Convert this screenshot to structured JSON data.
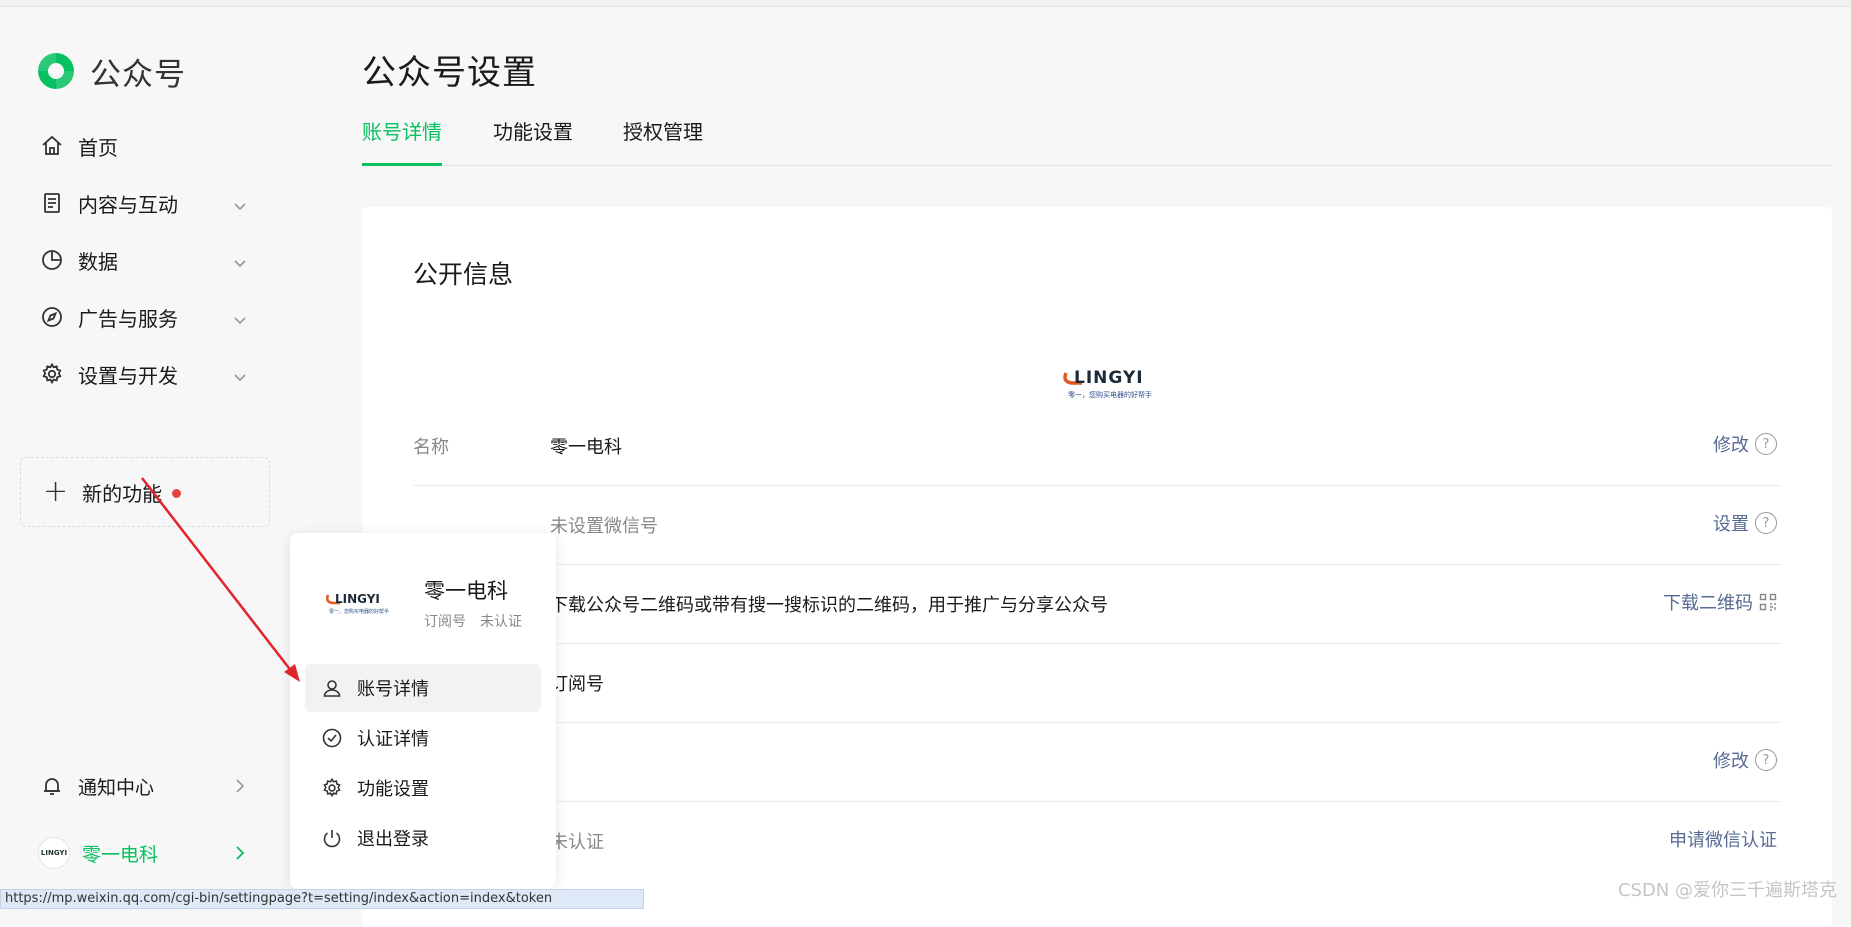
{
  "brand": {
    "title": "公众号"
  },
  "sidebar": {
    "items": [
      {
        "label": "首页",
        "icon": "home-icon"
      },
      {
        "label": "内容与互动",
        "icon": "document-icon"
      },
      {
        "label": "数据",
        "icon": "pie-chart-icon"
      },
      {
        "label": "广告与服务",
        "icon": "compass-icon"
      },
      {
        "label": "设置与开发",
        "icon": "gear-icon"
      }
    ],
    "new_feature": "新的功能",
    "notifications": "通知中心",
    "account_name": "零一电科"
  },
  "page": {
    "title": "公众号设置",
    "tabs": [
      "账号详情",
      "功能设置",
      "授权管理"
    ],
    "active_tab": 0
  },
  "card": {
    "title": "公开信息",
    "logo_text": "LINGYI",
    "logo_tagline": "零一，您购买电器的好帮手",
    "rows": [
      {
        "label": "名称",
        "value": "零一电科",
        "action": "修改",
        "help": true
      },
      {
        "label": "",
        "value": "未设置微信号",
        "action": "设置",
        "help": true,
        "muted": true
      },
      {
        "label": "",
        "value": "下载公众号二维码或带有搜一搜标识的二维码，用于推广与分享公众号",
        "action": "下载二维码",
        "qr": true
      },
      {
        "label": "",
        "value": "订阅号",
        "action": ""
      },
      {
        "label": "",
        "value": "",
        "action": "修改",
        "help": true
      },
      {
        "label": "",
        "value": "未认证",
        "action": "申请微信认证",
        "muted": true
      }
    ]
  },
  "popover": {
    "name": "零一电科",
    "type": "订阅号",
    "status": "未认证",
    "items": [
      {
        "label": "账号详情",
        "icon": "user-icon"
      },
      {
        "label": "认证详情",
        "icon": "check-circle-icon"
      },
      {
        "label": "功能设置",
        "icon": "gear-icon"
      },
      {
        "label": "退出登录",
        "icon": "power-icon"
      }
    ]
  },
  "status_url": "https://mp.weixin.qq.com/cgi-bin/settingpage?t=setting/index&action=index&token",
  "watermark": "CSDN @爱你三千遍斯塔克",
  "colors": {
    "accent": "#07c160",
    "link": "#576b95",
    "annotation_arrow": "#e0262a"
  }
}
